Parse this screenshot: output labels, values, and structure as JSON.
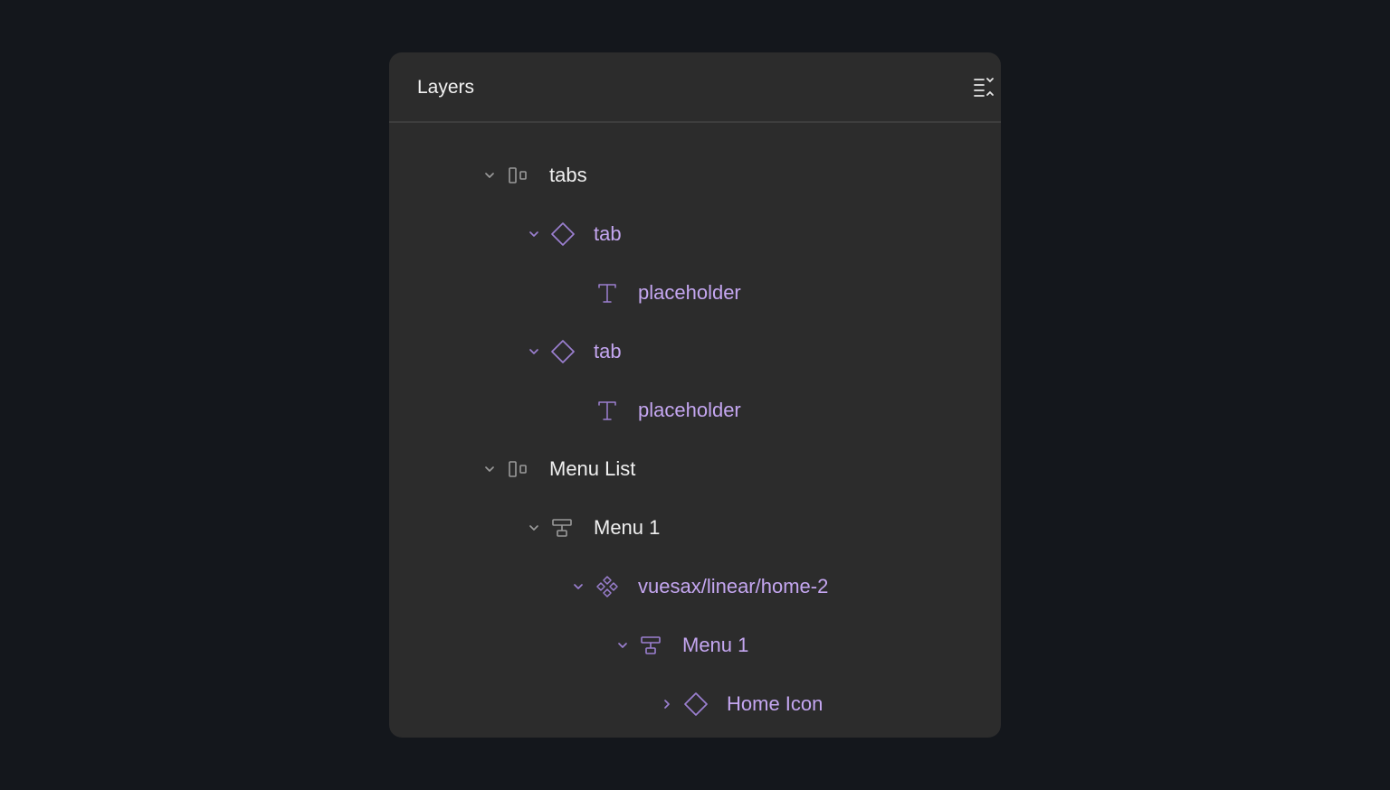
{
  "panel": {
    "title": "Layers",
    "collapse_icon": "collapse-all-icon"
  },
  "colors": {
    "background": "#14171c",
    "panel": "#2c2c2c",
    "text_primary": "#f0f0f0",
    "text_component": "#c4a6f0",
    "icon_muted": "#9a9a9a",
    "icon_component": "#9b7fd0"
  },
  "layers": [
    {
      "label": "tabs",
      "depth": 0,
      "icon": "auto-layout-horizontal-icon",
      "expanded": true,
      "tone": "white"
    },
    {
      "label": "tab",
      "depth": 1,
      "icon": "component-instance-icon",
      "expanded": true,
      "tone": "purple"
    },
    {
      "label": "placeholder",
      "depth": 2,
      "icon": "text-icon",
      "expanded": null,
      "tone": "purple"
    },
    {
      "label": "tab",
      "depth": 1,
      "icon": "component-instance-icon",
      "expanded": true,
      "tone": "purple"
    },
    {
      "label": "placeholder",
      "depth": 2,
      "icon": "text-icon",
      "expanded": null,
      "tone": "purple"
    },
    {
      "label": "Menu List",
      "depth": 0,
      "icon": "auto-layout-horizontal-icon",
      "expanded": true,
      "tone": "white"
    },
    {
      "label": "Menu 1",
      "depth": 1,
      "icon": "auto-layout-vertical-icon",
      "expanded": true,
      "tone": "white"
    },
    {
      "label": "vuesax/linear/home-2",
      "depth": 2,
      "icon": "component-set-icon",
      "expanded": true,
      "tone": "purple"
    },
    {
      "label": "Menu 1",
      "depth": 3,
      "icon": "auto-layout-vertical-icon",
      "expanded": true,
      "tone": "purple"
    },
    {
      "label": "Home Icon",
      "depth": 4,
      "icon": "component-instance-icon",
      "expanded": false,
      "tone": "purple"
    }
  ]
}
